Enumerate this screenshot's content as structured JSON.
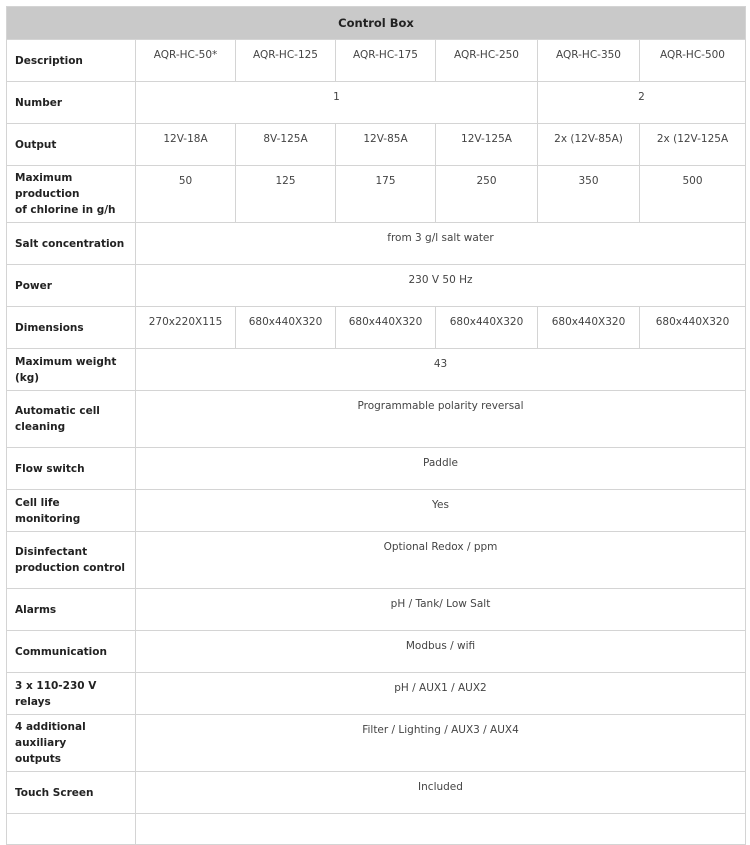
{
  "table": {
    "title": "Control Box",
    "description": {
      "label": "Description",
      "models": [
        "AQR-HC-50*",
        "AQR-HC-125",
        "AQR-HC-175",
        "AQR-HC-250",
        "AQR-HC-350",
        "AQR-HC-500"
      ]
    },
    "number": {
      "label": "Number",
      "group1": "1",
      "group2": "2"
    },
    "output": {
      "label": "Output",
      "values": [
        "12V-18A",
        "8V-125A",
        "12V-85A",
        "12V-125A",
        "2x (12V-85A)",
        "2x (12V-125A"
      ]
    },
    "max_chlorine": {
      "label_line1": "Maximum production",
      "label_line2": "of chlorine in g/h",
      "values": [
        "50",
        "125",
        "175",
        "250",
        "350",
        "500"
      ]
    },
    "salt": {
      "label": "Salt concentration",
      "value": "from 3 g/l salt water"
    },
    "power": {
      "label": "Power",
      "value": "230 V 50 Hz"
    },
    "dimensions": {
      "label": "Dimensions",
      "values": [
        "270x220X115",
        "680x440X320",
        "680x440X320",
        "680x440X320",
        "680x440X320",
        "680x440X320"
      ]
    },
    "max_weight": {
      "label": "Maximum weight (kg)",
      "value": "43"
    },
    "auto_clean": {
      "label_line1": "Automatic cell",
      "label_line2": "cleaning",
      "value": "Programmable polarity reversal"
    },
    "flow_switch": {
      "label": "Flow switch",
      "value": "Paddle"
    },
    "cell_life": {
      "label": "Cell life monitoring",
      "value": "Yes"
    },
    "disinfectant": {
      "label_line1": "Disinfectant",
      "label_line2": "production control",
      "value": "Optional Redox / ppm"
    },
    "alarms": {
      "label": "Alarms",
      "value": "pH / Tank/ Low Salt"
    },
    "communication": {
      "label": "Communication",
      "value": "Modbus / wifi"
    },
    "relays": {
      "label": "3 x 110-230 V relays",
      "value": "pH / AUX1 / AUX2"
    },
    "aux_outputs": {
      "label_line1": "4 additional auxiliary",
      "label_line2": "outputs",
      "value": "Filter / Lighting / AUX3 / AUX4"
    },
    "touch_screen": {
      "label": "Touch Screen",
      "value": "Included"
    }
  }
}
